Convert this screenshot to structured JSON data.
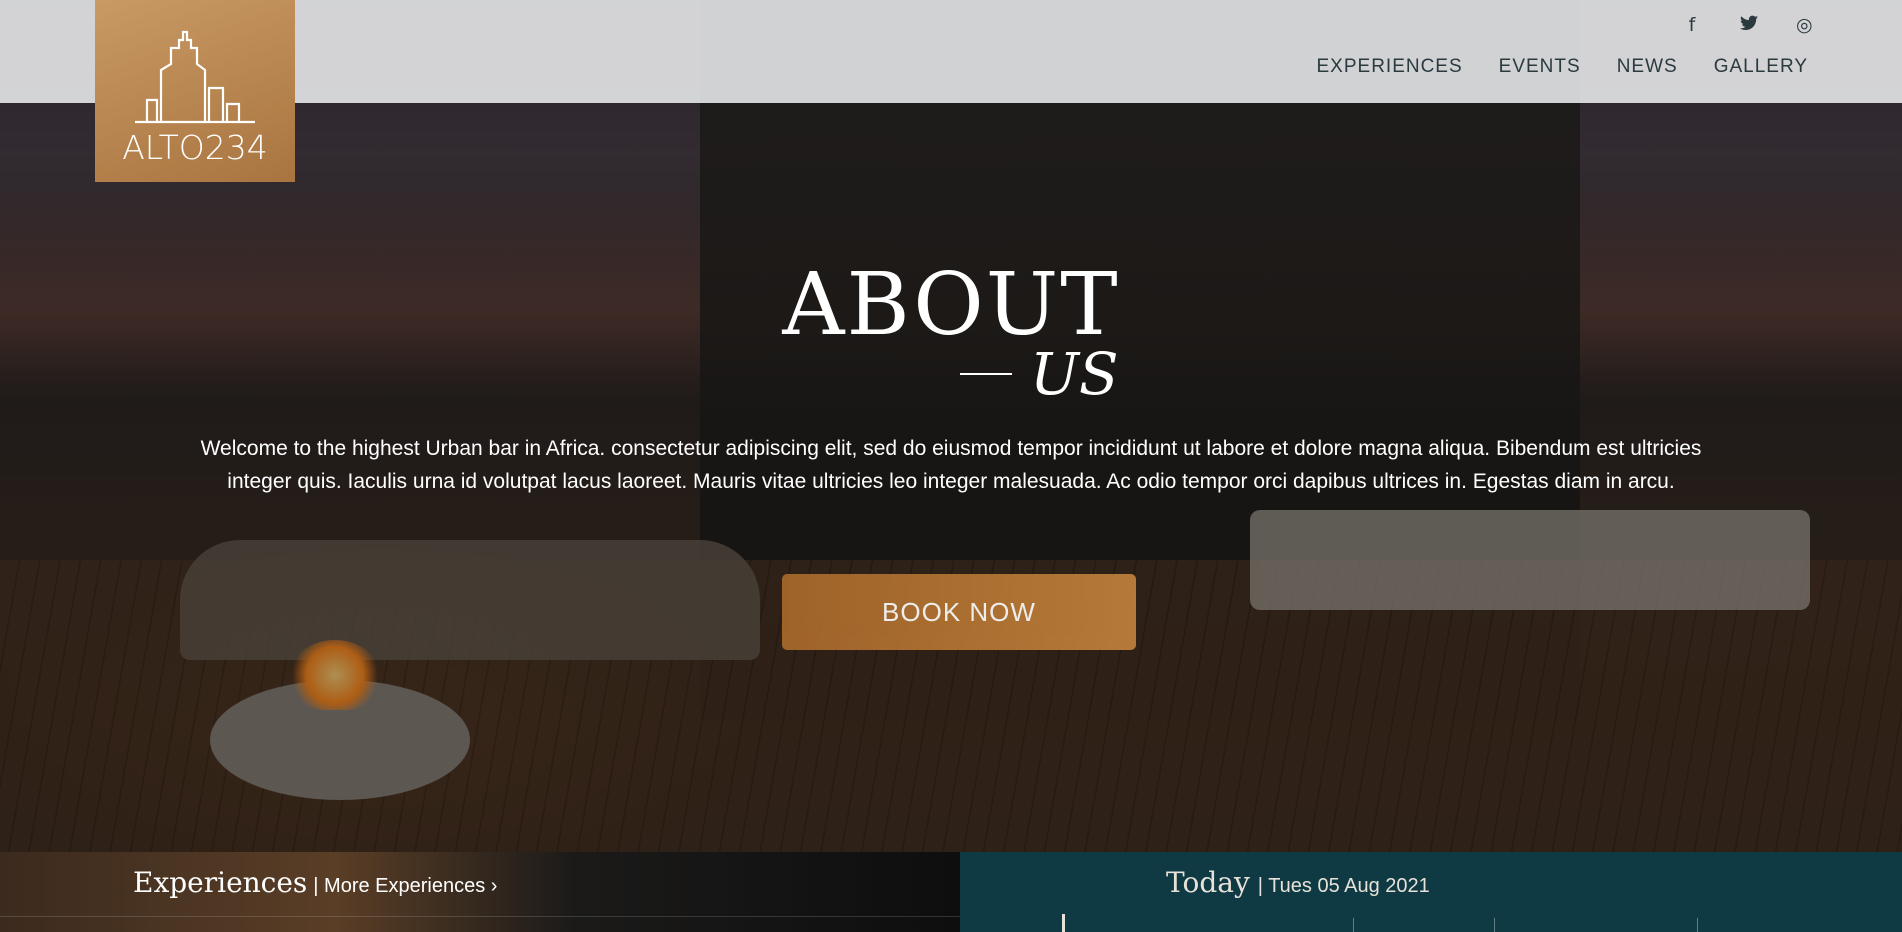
{
  "brand": {
    "logo_text": "ALTO234"
  },
  "social": {
    "facebook": "f",
    "twitter": "🐦",
    "instagram": "◎"
  },
  "nav": {
    "items": [
      "EXPERIENCES",
      "EVENTS",
      "NEWS",
      "GALLERY"
    ]
  },
  "hero": {
    "title": "ABOUT",
    "subtitle": "US",
    "intro": "Welcome to the highest Urban bar in Africa. consectetur adipiscing elit, sed do eiusmod tempor incididunt ut labore et dolore magna aliqua. Bibendum est ultricies integer quis. Iaculis urna id volutpat lacus laoreet. Mauris vitae ultricies leo integer malesuada. Ac odio tempor orci dapibus ultrices in. Egestas diam in arcu.",
    "cta": "BOOK NOW"
  },
  "experiences": {
    "heading": "Experiences",
    "more_link": "| More Experiences ›"
  },
  "today": {
    "heading": "Today",
    "date": "| Tues 05 Aug 2021"
  },
  "colors": {
    "brand_gold": "#b98548",
    "nav_text": "#2a3a3f",
    "teal_panel": "#0f3a44"
  }
}
